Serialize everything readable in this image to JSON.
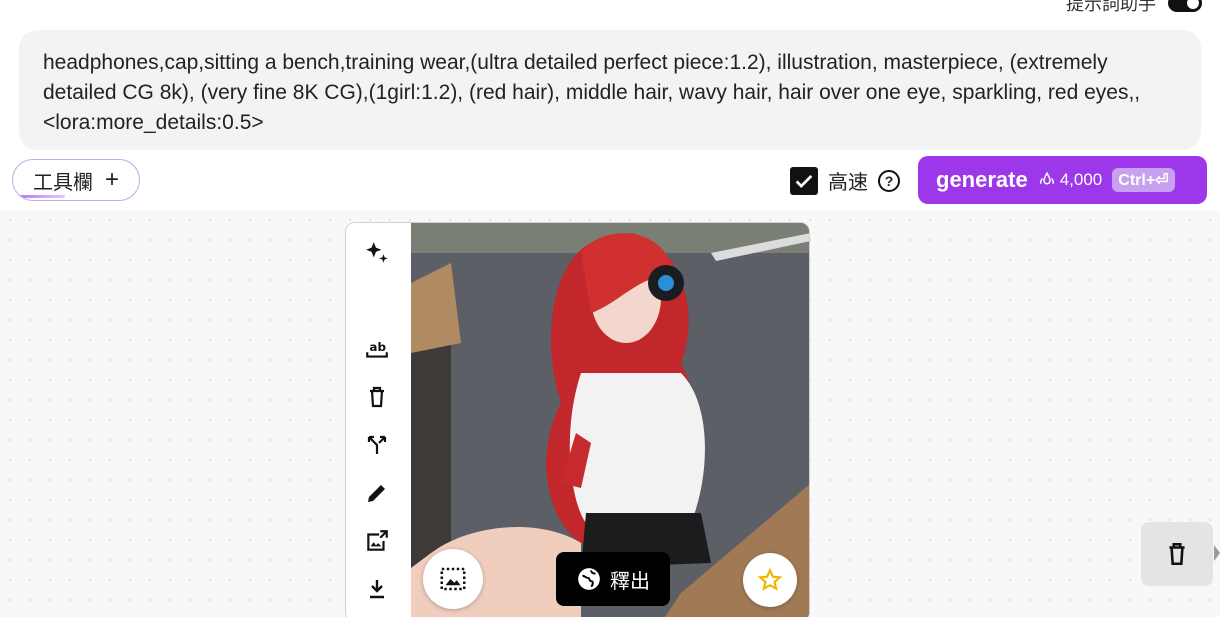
{
  "header": {
    "assistant_label": "提示詞助手",
    "assistant_toggle_on": true
  },
  "prompt": {
    "text": "headphones,cap,sitting a bench,training wear,(ultra detailed perfect piece:1.2), illustration, masterpiece, (extremely detailed CG 8k), (very fine 8K CG),(1girl:1.2), (red hair), middle hair, wavy hair, hair over one eye, sparkling, red eyes,,<lora:more_details:0.5>"
  },
  "toolbar": {
    "chip_label": "工具欄",
    "chip_icon": "plus-icon",
    "speed_label": "高速",
    "speed_checked": true,
    "help_icon": "help-icon"
  },
  "generate": {
    "label": "generate",
    "cost": "4,000",
    "cost_icon": "credits-icon",
    "shortcut": "Ctrl+⏎",
    "color": "#9d37ea"
  },
  "card": {
    "side_tools": [
      {
        "icon": "sparkle-icon"
      },
      {
        "icon": "text-rename-icon"
      },
      {
        "icon": "trash-icon"
      },
      {
        "icon": "branch-icon"
      },
      {
        "icon": "pencil-icon"
      },
      {
        "icon": "image-export-icon"
      },
      {
        "icon": "download-icon"
      }
    ],
    "image_alt_icon": "generated-image",
    "release_label": "釋出",
    "release_icon": "globe-icon",
    "star_color": "#f2b500"
  },
  "floating": {
    "delete_icon": "trash-icon"
  }
}
